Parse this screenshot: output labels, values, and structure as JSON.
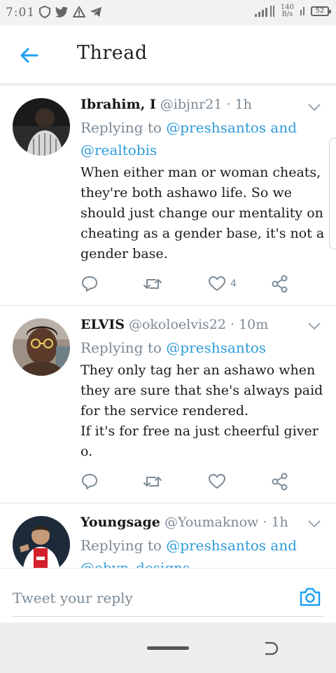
{
  "status_bar": {
    "time": "7:01",
    "net_speed_value": "140",
    "net_speed_unit": "B/s",
    "network_type": "4G",
    "battery": "52"
  },
  "header": {
    "title": "Thread"
  },
  "tweets": [
    {
      "name": "Ibrahim, I",
      "handle": "@ibjnr21",
      "time": "1h",
      "replying_prefix": "Replying to",
      "mentions": "@preshsantos and @realtobis",
      "text": "When either man or woman cheats, they're both ashawo life. So we should just change our mentality on cheating as a gender base, it's not a gender base.",
      "like_count": "4"
    },
    {
      "name": "ELVIS",
      "handle": "@okoloelvis22",
      "time": "10m",
      "replying_prefix": "Replying to",
      "mentions": "@preshsantos",
      "text": "They only tag her an ashawo when they are sure that she's always paid for the service rendered.\nIf it's for free na just cheerful giver o.",
      "like_count": ""
    },
    {
      "name": "Youngsage",
      "handle": "@Youmaknow",
      "time": "1h",
      "replying_prefix": "Replying to",
      "mentions": "@preshsantos and @obyn_designs",
      "text": "",
      "like_count": ""
    }
  ],
  "reply_bar": {
    "placeholder": "Tweet your reply"
  },
  "colors": {
    "accent": "#1da1f2",
    "mention": "#2f9bd9",
    "secondary_text": "#7b8a96",
    "divider": "#dfe6ec"
  },
  "icons": {
    "back": "arrow-left-icon",
    "caret": "chevron-down-icon",
    "reply": "speech-bubble-icon",
    "retweet": "retweet-icon",
    "like": "heart-icon",
    "share": "share-icon",
    "camera": "camera-icon"
  }
}
